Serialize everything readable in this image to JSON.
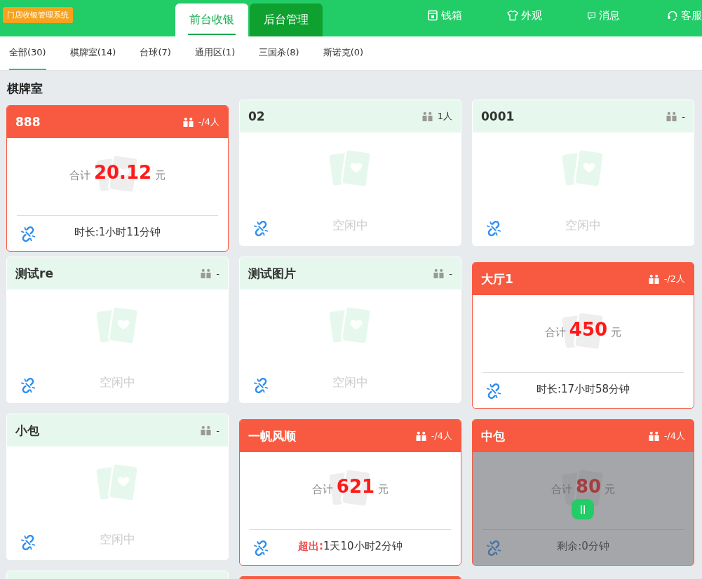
{
  "app_badge": "门店收银管理系统",
  "main_tabs": [
    {
      "label": "前台收银",
      "selected": true
    },
    {
      "label": "后台管理",
      "selected": false
    }
  ],
  "toolbar": [
    {
      "kind": "cashbox",
      "label": "钱箱"
    },
    {
      "kind": "shirt",
      "label": "外观"
    },
    {
      "kind": "message",
      "label": "消息"
    },
    {
      "kind": "headset",
      "label": "客服"
    }
  ],
  "category_tabs": [
    {
      "label": "全部(30)",
      "selected": true
    },
    {
      "label": "棋牌室(14)",
      "selected": false
    },
    {
      "label": "台球(7)",
      "selected": false
    },
    {
      "label": "通用区(1)",
      "selected": false
    },
    {
      "label": "三国杀(8)",
      "selected": false
    },
    {
      "label": "斯诺克(0)",
      "selected": false
    }
  ],
  "section_title": "棋牌室",
  "rooms": [
    {
      "name": "888",
      "occupied": true,
      "paused": false,
      "people": "-/4人",
      "total_label": "合计",
      "amount": "20.12",
      "unit": "元",
      "duration": "时长:1小时11分钟"
    },
    {
      "name": "02",
      "occupied": false,
      "paused": false,
      "people": "1人",
      "idle_text": "空闲中"
    },
    {
      "name": "0001",
      "occupied": false,
      "paused": false,
      "people": "-",
      "idle_text": "空闲中"
    },
    {
      "name": "测试re",
      "occupied": false,
      "paused": false,
      "people": "-",
      "idle_text": "空闲中"
    },
    {
      "name": "测试图片",
      "occupied": false,
      "paused": false,
      "people": "-",
      "idle_text": "空闲中"
    },
    {
      "name": "大厅1",
      "occupied": true,
      "paused": false,
      "people": "-/2人",
      "total_label": "合计",
      "amount": "450",
      "unit": "元",
      "duration": "时长:17小时58分钟"
    },
    {
      "name": "小包",
      "occupied": false,
      "paused": false,
      "people": "-",
      "idle_text": "空闲中"
    },
    {
      "name": "一帆风顺",
      "occupied": true,
      "paused": false,
      "people": "-/4人",
      "total_label": "合计",
      "amount": "621",
      "unit": "元",
      "overtime_label": "超出:",
      "duration": "1天10小时2分钟"
    },
    {
      "name": "中包",
      "occupied": true,
      "paused": true,
      "people": "-/4人",
      "total_label": "合计",
      "amount": "80",
      "unit": "元",
      "duration": "剩余:0分钟"
    },
    {
      "occupied": false,
      "paused": false
    },
    {
      "occupied": true,
      "paused": false
    }
  ]
}
